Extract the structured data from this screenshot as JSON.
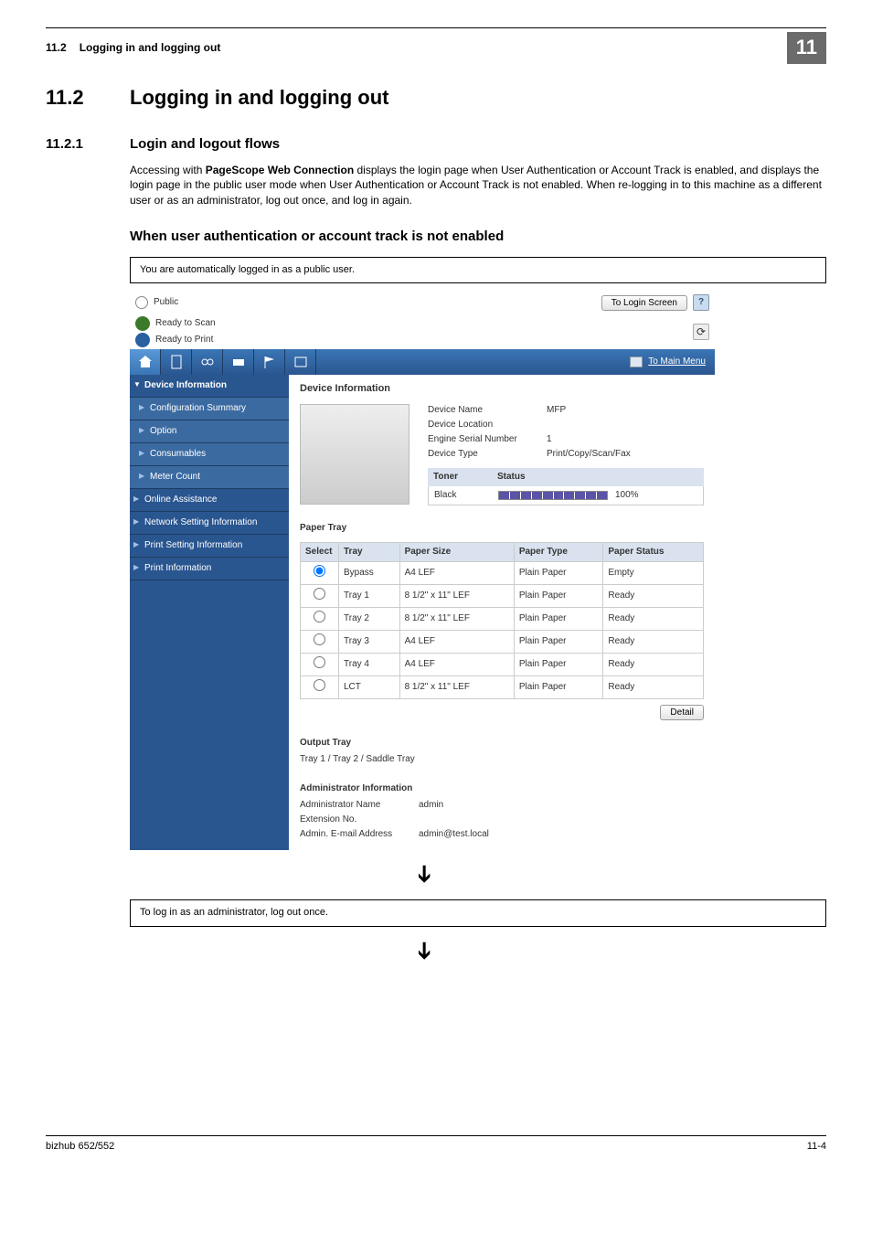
{
  "header": {
    "section_num": "11.2",
    "section_title": "Logging in and logging out",
    "chapter_badge": "11"
  },
  "h2": {
    "num": "11.2",
    "title": "Logging in and logging out"
  },
  "h3": {
    "num": "11.2.1",
    "title": "Login and logout flows"
  },
  "para": {
    "pre": "Accessing with ",
    "bold": "PageScope Web Connection",
    "post": " displays the login page when User Authentication or Account Track is enabled, and displays the login page in the public user mode when User Authentication or Account Track is not enabled. When re-logging in to this machine as a different user or as an administrator, log out once, and log in again."
  },
  "h4": "When user authentication or account track is not enabled",
  "cap1": "You are automatically logged in as a public user.",
  "cap2": "To log in as an administrator, log out once.",
  "ss": {
    "user_mode": "Public",
    "login_btn": "To Login Screen",
    "help_glyph": "?",
    "status_scan": "Ready to Scan",
    "status_print": "Ready to Print",
    "refresh_glyph": "⟳",
    "mainmenu": "To Main Menu",
    "tab_icons": [
      "home-icon",
      "doc-icon",
      "link-icon",
      "print-icon",
      "flag-icon",
      "fax-icon"
    ],
    "sidebar": [
      {
        "label": "Device Information",
        "cls": "open active"
      },
      {
        "label": "Configuration Summary",
        "cls": "sub"
      },
      {
        "label": "Option",
        "cls": "sub"
      },
      {
        "label": "Consumables",
        "cls": "sub"
      },
      {
        "label": "Meter Count",
        "cls": "sub"
      },
      {
        "label": "Online Assistance",
        "cls": ""
      },
      {
        "label": "Network Setting Information",
        "cls": ""
      },
      {
        "label": "Print Setting Information",
        "cls": ""
      },
      {
        "label": "Print Information",
        "cls": ""
      }
    ],
    "main_heading": "Device Information",
    "devinfo": {
      "name_k": "Device Name",
      "name_v": "MFP",
      "loc_k": "Device Location",
      "loc_v": "",
      "serial_k": "Engine Serial Number",
      "serial_v": "1",
      "type_k": "Device Type",
      "type_v": "Print/Copy/Scan/Fax"
    },
    "toner": {
      "h1": "Toner",
      "h2": "Status",
      "row_label": "Black",
      "row_pct": "100%"
    },
    "paper_heading": "Paper Tray",
    "paper_cols": [
      "Select",
      "Tray",
      "Paper Size",
      "Paper Type",
      "Paper Status"
    ],
    "paper_rows": [
      {
        "sel": true,
        "tray": "Bypass",
        "size": "A4 LEF",
        "type": "Plain Paper",
        "status": "Empty"
      },
      {
        "sel": false,
        "tray": "Tray 1",
        "size": "8 1/2\" x 11\" LEF",
        "type": "Plain Paper",
        "status": "Ready"
      },
      {
        "sel": false,
        "tray": "Tray 2",
        "size": "8 1/2\" x 11\" LEF",
        "type": "Plain Paper",
        "status": "Ready"
      },
      {
        "sel": false,
        "tray": "Tray 3",
        "size": "A4 LEF",
        "type": "Plain Paper",
        "status": "Ready"
      },
      {
        "sel": false,
        "tray": "Tray 4",
        "size": "A4 LEF",
        "type": "Plain Paper",
        "status": "Ready"
      },
      {
        "sel": false,
        "tray": "LCT",
        "size": "8 1/2\" x 11\" LEF",
        "type": "Plain Paper",
        "status": "Ready"
      }
    ],
    "detail_btn": "Detail",
    "output": {
      "heading": "Output Tray",
      "value": "Tray 1 / Tray 2 / Saddle Tray"
    },
    "admin": {
      "heading": "Administrator Information",
      "name_k": "Administrator Name",
      "name_v": "admin",
      "ext_k": "Extension No.",
      "ext_v": "",
      "mail_k": "Admin. E-mail Address",
      "mail_v": "admin@test.local"
    }
  },
  "footer": {
    "left": "bizhub 652/552",
    "right": "11-4"
  }
}
